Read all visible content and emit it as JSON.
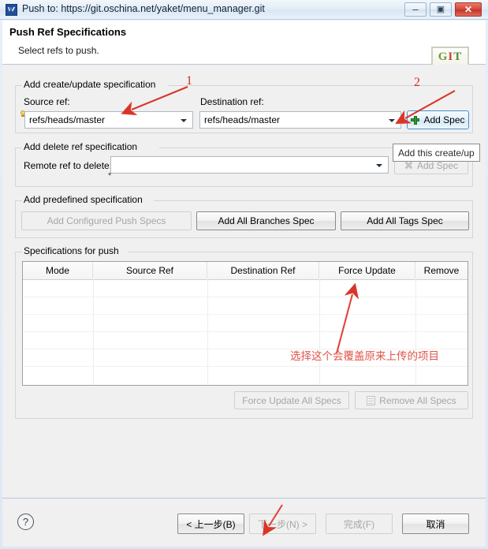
{
  "window": {
    "title": "Push to: https://git.oschina.net/yaket/menu_manager.git",
    "app_icon": "git-app-icon",
    "controls": {
      "minimize": "–",
      "maximize": "▣",
      "close": "✕"
    }
  },
  "header": {
    "title": "Push Ref Specifications",
    "subtitle": "Select refs to push.",
    "logo_text": {
      "g": "G",
      "i": "I",
      "t": "T"
    }
  },
  "create_update_group": {
    "title": "Add create/update specification",
    "source_label": "Source ref:",
    "source_value": "refs/heads/master",
    "destination_label": "Destination ref:",
    "destination_value": "refs/heads/master",
    "add_spec_label": "Add Spec"
  },
  "tooltip": {
    "text": "Add this create/up"
  },
  "delete_group": {
    "title": "Add delete ref specification",
    "remote_label": "Remote ref to delete:",
    "remote_value": "",
    "remote_placeholder": "",
    "add_spec_label": "Add Spec",
    "star": "*"
  },
  "predefined_group": {
    "title": "Add predefined specification",
    "buttons": [
      {
        "label": "Add Configured Push Specs",
        "enabled": false
      },
      {
        "label": "Add All Branches Spec",
        "enabled": true
      },
      {
        "label": "Add All Tags Spec",
        "enabled": true
      }
    ]
  },
  "specs_group": {
    "title": "Specifications for push",
    "columns": [
      "Mode",
      "Source Ref",
      "Destination Ref",
      "Force Update",
      "Remove"
    ],
    "rows": [],
    "force_update_all_label": "Force Update All Specs",
    "remove_all_label": "Remove All Specs"
  },
  "buttonbar": {
    "help": "?",
    "back": "< 上一步(B)",
    "next": "下一步(N) >",
    "finish": "完成(F)",
    "cancel": "取消"
  },
  "annotations": {
    "num1": "1",
    "num2": "2",
    "chinese_note": "选择这个会覆盖原来上传的项目",
    "color": "#d9352a"
  }
}
